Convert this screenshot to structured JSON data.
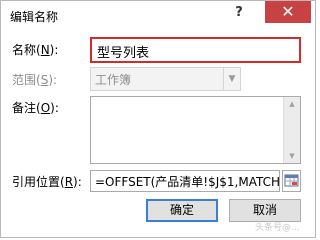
{
  "dialog": {
    "title": "编辑名称",
    "help_symbol": "?",
    "close_symbol": "✕"
  },
  "fields": {
    "name_label": "名称(",
    "name_key": "N",
    "name_label_end": "):",
    "name_value": "型号列表",
    "scope_label": "范围(",
    "scope_key": "S",
    "scope_label_end": "):",
    "scope_value": "工作簿",
    "comment_label": "备注(",
    "comment_key": "O",
    "comment_label_end": "):",
    "comment_value": "",
    "refers_label": "引用位置(",
    "refers_key": "R",
    "refers_label_end": "):",
    "refers_value": "=OFFSET(产品清单!$J$1,MATCH"
  },
  "buttons": {
    "ok_label": "确定",
    "cancel_label": "取消"
  },
  "watermark": "头条号@..."
}
